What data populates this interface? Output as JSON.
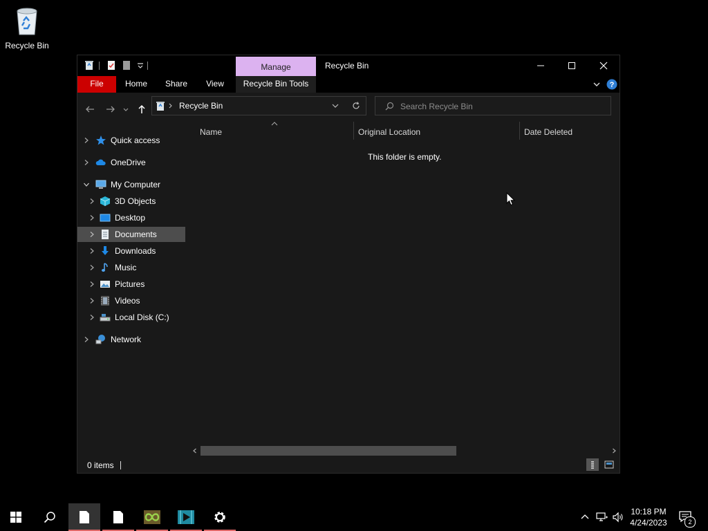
{
  "desktop": {
    "recycle_bin_label": "Recycle Bin"
  },
  "window": {
    "title": "Recycle Bin",
    "manage_tab": "Manage",
    "tabs": {
      "file": "File",
      "home": "Home",
      "share": "Share",
      "view": "View",
      "recycle_bin_tools": "Recycle Bin Tools"
    },
    "address": {
      "path_segment": "Recycle Bin"
    },
    "search": {
      "placeholder": "Search Recycle Bin"
    },
    "nav": {
      "quick_access": "Quick access",
      "onedrive": "OneDrive",
      "my_computer": "My Computer",
      "objects_3d": "3D Objects",
      "desktop": "Desktop",
      "documents": "Documents",
      "downloads": "Downloads",
      "music": "Music",
      "pictures": "Pictures",
      "videos": "Videos",
      "local_disk": "Local Disk (C:)",
      "network": "Network"
    },
    "columns": {
      "name": "Name",
      "original_location": "Original Location",
      "date_deleted": "Date Deleted"
    },
    "empty_message": "This folder is empty.",
    "status": {
      "items": "0 items"
    }
  },
  "taskbar": {
    "time": "10:18 PM",
    "date": "4/24/2023",
    "notification_count": "2"
  },
  "colors": {
    "file_tab": "#cc0000",
    "manage_tab": "#dcb2f0",
    "selection": "#4d4d4d",
    "accent_blue": "#2f7fd6"
  }
}
